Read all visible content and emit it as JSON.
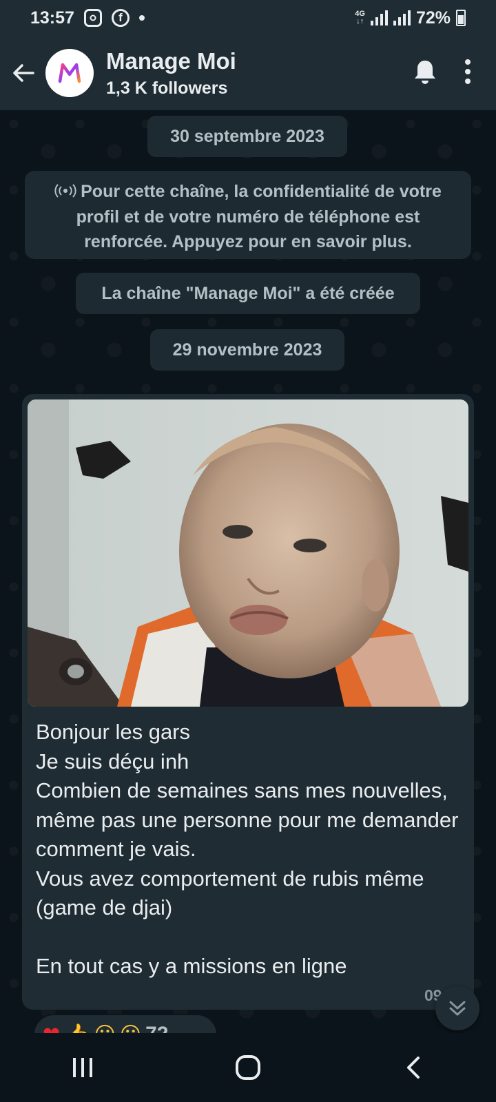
{
  "status_bar": {
    "time": "13:57",
    "network": "4G",
    "battery": "72%",
    "battery_level": 0.72
  },
  "header": {
    "channel_name": "Manage Moi",
    "followers": "1,3 K followers",
    "icons": [
      "back-arrow-icon",
      "channel-logo",
      "bell-icon",
      "more-vertical-icon"
    ]
  },
  "chat": {
    "date_1": "30 septembre 2023",
    "privacy_notice": "Pour cette chaîne, la confidentialité de votre profil et de votre numéro de téléphone est renforcée. Appuyez pour en savoir plus.",
    "created_notice": "La chaîne \"Manage Moi\" a été créée",
    "date_2": "29 novembre 2023",
    "message": {
      "text": "Bonjour les gars\nJe suis déçu inh\nCombien de semaines sans mes nouvelles, même pas une personne pour me demander comment je vais.\nVous avez comportement de rubis même (game de djai)\n\nEn tout cas y a missions en ligne",
      "time": "09:",
      "reaction_count": "72"
    }
  },
  "colors": {
    "background": "#0b141a",
    "bar": "#1f2c34",
    "pill": "#1d2a31",
    "text": "#e9edef",
    "muted": "#8696a0"
  }
}
